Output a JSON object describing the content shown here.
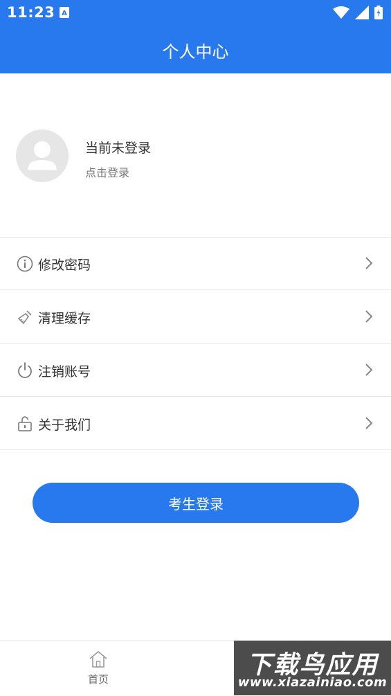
{
  "status_bar": {
    "time": "11:23",
    "icons": [
      "notification-a-icon",
      "wifi-icon",
      "signal-icon",
      "battery-icon"
    ]
  },
  "header": {
    "title": "个人中心"
  },
  "profile": {
    "status_text": "当前未登录",
    "hint_text": "点击登录",
    "avatar_icon": "user-avatar-icon"
  },
  "menu": {
    "items": [
      {
        "label": "修改密码",
        "icon": "info-circle-icon"
      },
      {
        "label": "清理缓存",
        "icon": "broom-icon"
      },
      {
        "label": "注销账号",
        "icon": "power-icon"
      },
      {
        "label": "关于我们",
        "icon": "unlock-icon"
      }
    ]
  },
  "login_button": {
    "label": "考生登录"
  },
  "tab_bar": {
    "home_label": "首页",
    "home_icon": "home-icon"
  },
  "watermark": {
    "title": "下载鸟应用",
    "url": "www.xiazainiao.com"
  },
  "colors": {
    "primary": "#2979ee",
    "divider": "#e4e4e4",
    "text": "#333333",
    "subtext": "#777777"
  }
}
